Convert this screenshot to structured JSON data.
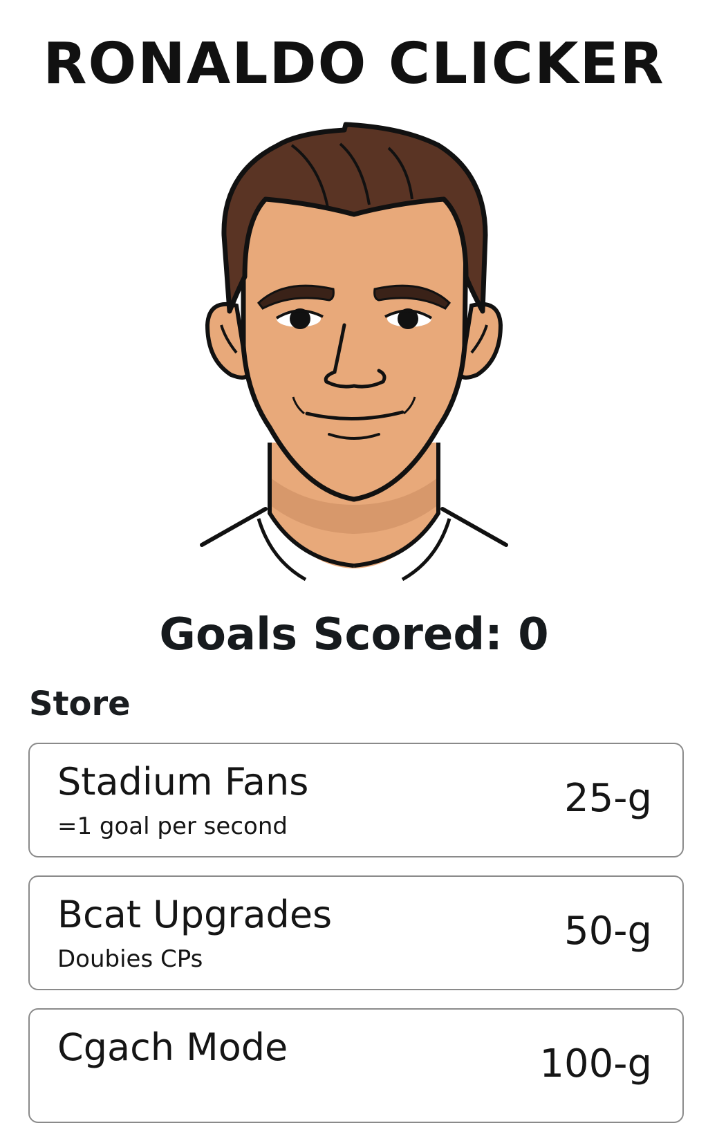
{
  "game": {
    "title": "RONALDO CLICKER"
  },
  "player": {
    "icon": "ronaldo-face-icon",
    "colors": {
      "skin": "#e8a97a",
      "skin_shadow": "#c98b5e",
      "hair": "#5a3424",
      "outline": "#111111",
      "shirt": "#ffffff"
    }
  },
  "score": {
    "label": "Goals Scored:",
    "value": "0"
  },
  "store": {
    "heading": "Store",
    "items": [
      {
        "name": "Stadium Fans",
        "description": "=1 goal per second",
        "cost": "25-g"
      },
      {
        "name": "Bcat Upgrades",
        "description": "Doubies CPs",
        "cost": "50-g"
      },
      {
        "name": "Cgach Mode",
        "description": "",
        "cost": "100-g"
      }
    ]
  }
}
